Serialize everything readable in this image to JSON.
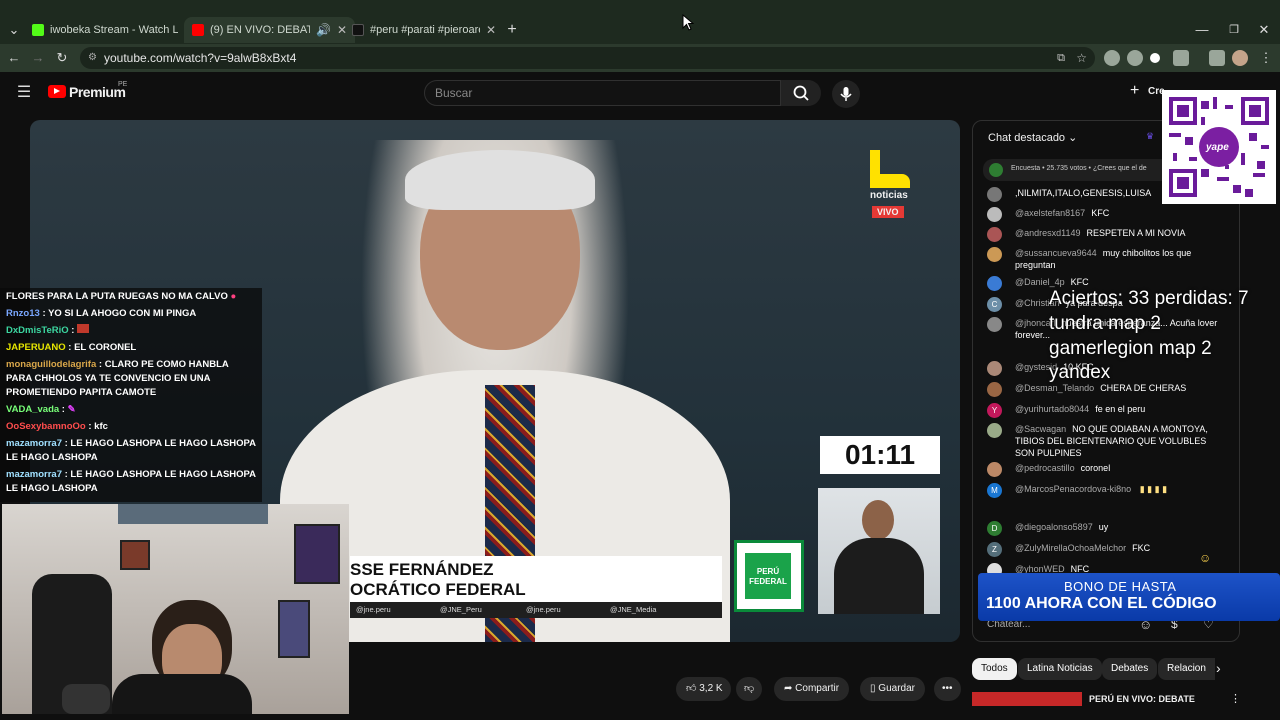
{
  "tabs": [
    {
      "title": "iwobeka Stream - Watch Live o",
      "color": "#53fc18"
    },
    {
      "title": "(9) EN VIVO: DEBATE PRESI",
      "color": "#ff0000"
    },
    {
      "title": "#peru #parati #pieroarenas #k",
      "color": "#000000"
    }
  ],
  "address": {
    "url": "youtube.com/watch?v=9alwB8xBxt4"
  },
  "youtube": {
    "brand": "Premium",
    "region": "PE",
    "search_placeholder": "Buscar",
    "create_label": "Cre"
  },
  "video": {
    "channel_mark": "noticias",
    "live_badge": "VIVO",
    "timer": "01:11",
    "lower_third_name": "SSE FERNÁNDEZ",
    "lower_third_party": "OCRÁTICO FEDERAL",
    "socials": [
      "@jne.peru",
      "@JNE_Peru",
      "@jne.peru",
      "@JNE_Media"
    ],
    "party_logo_text": "PERÚ FEDERAL"
  },
  "stream_chat": [
    {
      "user": "",
      "text": "FLORES PARA LA PUTA RUEGAS NO MA CALVO",
      "color": "#ffffff"
    },
    {
      "user": "Rnzo13",
      "text": ": YO SI LA AHOGO CON MI PINGA",
      "color": "#7aa7ff"
    },
    {
      "user": "DxDmisTeRiO",
      "text": ":",
      "color": "#3cd6a0"
    },
    {
      "user": "JAPERUANO",
      "text": ": EL CORONEL",
      "color": "#e6e600"
    },
    {
      "user": "monaguillodelagrifa",
      "text": ": CLARO PE COMO HANBLA PARA CHHOLOS YA TE CONVENCIO EN UNA PROMETIENDO PAPITA CAMOTE",
      "color": "#d9a74a"
    },
    {
      "user": "VADA_vada",
      "text": ":",
      "color": "#78ff78"
    },
    {
      "user": "OoSexybamnoOo",
      "text": ": kfc",
      "color": "#ff4d4d"
    },
    {
      "user": "mazamorra7",
      "text": ": LE HAGO LASHOPA  LE HAGO LASHOPA  LE HAGO LASHOPA",
      "color": "#a0e0ff"
    },
    {
      "user": "mazamorra7",
      "text": ": LE HAGO LASHOPA  LE HAGO LASHOPA  LE HAGO LASHOPA",
      "color": "#a0e0ff"
    }
  ],
  "chat": {
    "header": "Chat destacado",
    "poll_text": "Encuesta • 25.735 votos • ¿Crees que el de",
    "input_placeholder": "Chatear...",
    "messages": [
      {
        "author": "",
        "text": ",NILMITA,ITALO,GENESIS,LUISA",
        "av": "#777"
      },
      {
        "author": "@axelstefan8167",
        "text": "KFC",
        "av": "#bbb"
      },
      {
        "author": "@andresxd1149",
        "text": "RESPETEN A MI NOVIA",
        "av": "#a55"
      },
      {
        "author": "@sussancueva9644",
        "text": "muy chibolitos los que preguntan",
        "av": "#c95"
      },
      {
        "author": "@Daniel_4p",
        "text": "KFC",
        "av": "#3a7bd5"
      },
      {
        "author": "@Christian",
        "text": "ya para despa",
        "av": "#6d8fa8"
      },
      {
        "author": "@jhoncarl",
        "text": "nuestra unica esperanza... Acuña lover forever...",
        "av": "#888"
      },
      {
        "author": "@gystesid",
        "text": "10 KFC",
        "av": "#a87"
      },
      {
        "author": "@Desman_Telando",
        "text": "CHERA DE CHERAS",
        "av": "#964"
      },
      {
        "author": "@yurihurtado8044",
        "text": "fe en el peru",
        "av": "#c2185b"
      },
      {
        "author": "@Sacwagan",
        "text": "NO QUE ODIABAN A MONTOYA, TIBIOS DEL BICENTENARIO QUE VOLUBLES SON PULPINES",
        "av": "#9a8"
      },
      {
        "author": "@pedrocastillo",
        "text": "coronel",
        "av": "#b86"
      },
      {
        "author": "@MarcosPenacordova-ki8no",
        "text": "",
        "av": "#1976d2"
      },
      {
        "author": "@diegoalonso5897",
        "text": "uy",
        "av": "#2e7d32"
      },
      {
        "author": "@ZulyMirellaOchoaMelchor",
        "text": "FKC",
        "av": "#546e7a"
      },
      {
        "author": "@yhonWED",
        "text": "NFC",
        "av": "#ddd"
      }
    ]
  },
  "overlay_lines": [
    "Aciertos: 33 perdidas: 7",
    "tundra map 2",
    "gamerlegion map 2",
    "yandex"
  ],
  "promo": {
    "line1": "BONO DE HASTA",
    "line2": "1100 AHORA CON EL CÓDIGO"
  },
  "qr_caption": "yape",
  "actions": {
    "likes": "3,2 K",
    "share": "Compartir",
    "save": "Guardar"
  },
  "chips": [
    "Todos",
    "Latina Noticias",
    "Debates",
    "Relacion"
  ],
  "related_title": "PERÚ EN VIVO: DEBATE"
}
